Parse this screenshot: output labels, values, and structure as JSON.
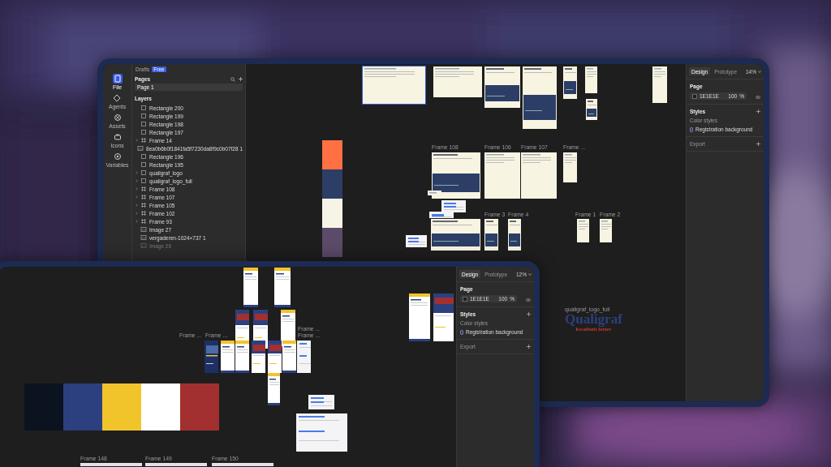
{
  "back_window": {
    "file_header": {
      "label": "Drafts",
      "badge": "Free"
    },
    "rail": [
      {
        "label": "File",
        "selected": true
      },
      {
        "label": "Agents",
        "selected": false
      },
      {
        "label": "Assets",
        "selected": false
      },
      {
        "label": "Icons",
        "selected": false
      },
      {
        "label": "Variables",
        "selected": false
      }
    ],
    "pages": {
      "title": "Pages",
      "items": [
        {
          "label": "Page 1",
          "selected": true
        }
      ]
    },
    "layers": {
      "title": "Layers",
      "items": [
        {
          "kind": "rect",
          "label": "Rectangle 200",
          "collapsible": false,
          "hidden": false
        },
        {
          "kind": "rect",
          "label": "Rectangle 199",
          "collapsible": false,
          "hidden": false
        },
        {
          "kind": "rect",
          "label": "Rectangle 198",
          "collapsible": false,
          "hidden": false
        },
        {
          "kind": "rect",
          "label": "Rectangle 197",
          "collapsible": false,
          "hidden": false
        },
        {
          "kind": "frame",
          "label": "Frame 14",
          "collapsible": true,
          "hidden": false
        },
        {
          "label": "8ea0b6b0f1841fa5f7230da8f9c0b07f28 1",
          "collapsible": false,
          "hidden": false
        },
        {
          "kind": "rect",
          "label": "Rectangle 196",
          "collapsible": false,
          "hidden": false
        },
        {
          "kind": "rect",
          "label": "Rectangle 195",
          "collapsible": false,
          "hidden": false
        },
        {
          "kind": "rect",
          "label": "qualigraf_logo",
          "collapsible": true,
          "hidden": false
        },
        {
          "kind": "rect",
          "label": "qualigraf_logo_full",
          "collapsible": true,
          "hidden": false
        },
        {
          "kind": "frame",
          "label": "Frame 108",
          "collapsible": true,
          "hidden": false
        },
        {
          "kind": "frame",
          "label": "Frame 107",
          "collapsible": true,
          "hidden": false
        },
        {
          "kind": "frame",
          "label": "Frame 105",
          "collapsible": true,
          "hidden": false
        },
        {
          "kind": "frame",
          "label": "Frame 102",
          "collapsible": true,
          "hidden": false
        },
        {
          "kind": "frame",
          "label": "Frame 93",
          "collapsible": true,
          "hidden": false
        },
        {
          "label": "Image 27",
          "collapsible": false,
          "hidden": false
        },
        {
          "label": "vergaderen-1024×737 1",
          "collapsible": false,
          "hidden": false
        },
        {
          "label": "Image 26",
          "collapsible": false,
          "hidden": true
        }
      ]
    },
    "canvas": {
      "swatches": [
        {
          "color": "#ff7043"
        },
        {
          "color": "#2c3e66"
        },
        {
          "color": "#f7f4e6"
        },
        {
          "color": "#5b4a68"
        }
      ],
      "frame_labels": [
        "Frame 108",
        "Frame 106",
        "Frame 107",
        "Frame ...",
        "Frame 3",
        "Frame 4",
        "Frame 1",
        "Frame 2"
      ],
      "logo": {
        "caption": "qualigraf_logo_full",
        "wordmark": "Qualigraf",
        "tagline": "kwaliteit letter"
      }
    },
    "design_panel": {
      "tabs": [
        {
          "label": "Design",
          "selected": true
        },
        {
          "label": "Prototype",
          "selected": false
        }
      ],
      "zoom": "14%",
      "page_title": "Page",
      "fill": "1E1E1E",
      "opacity": "100",
      "unit": "%",
      "styles_title": "Styles",
      "color_styles_title": "Color styles",
      "color_style": "Registration background",
      "export_title": "Export"
    }
  },
  "front_window": {
    "canvas": {
      "swatches": [
        {
          "color": "#0b1220"
        },
        {
          "color": "#2c4080"
        },
        {
          "color": "#f2c42c"
        },
        {
          "color": "#ffffff"
        },
        {
          "color": "#a33030"
        }
      ],
      "frame_labels": [
        "Frame ...",
        "Frame ...",
        "Frame ...",
        "Frame ...",
        "Frame 148",
        "Frame 149",
        "Frame 150"
      ]
    },
    "design_panel": {
      "tabs": [
        {
          "label": "Design",
          "selected": true
        },
        {
          "label": "Prototype",
          "selected": false
        }
      ],
      "zoom": "12%",
      "page_title": "Page",
      "fill": "1E1E1E",
      "opacity": "100",
      "unit": "%",
      "styles_title": "Styles",
      "color_styles_title": "Color styles",
      "color_style": "Registration background",
      "export_title": "Export"
    }
  }
}
